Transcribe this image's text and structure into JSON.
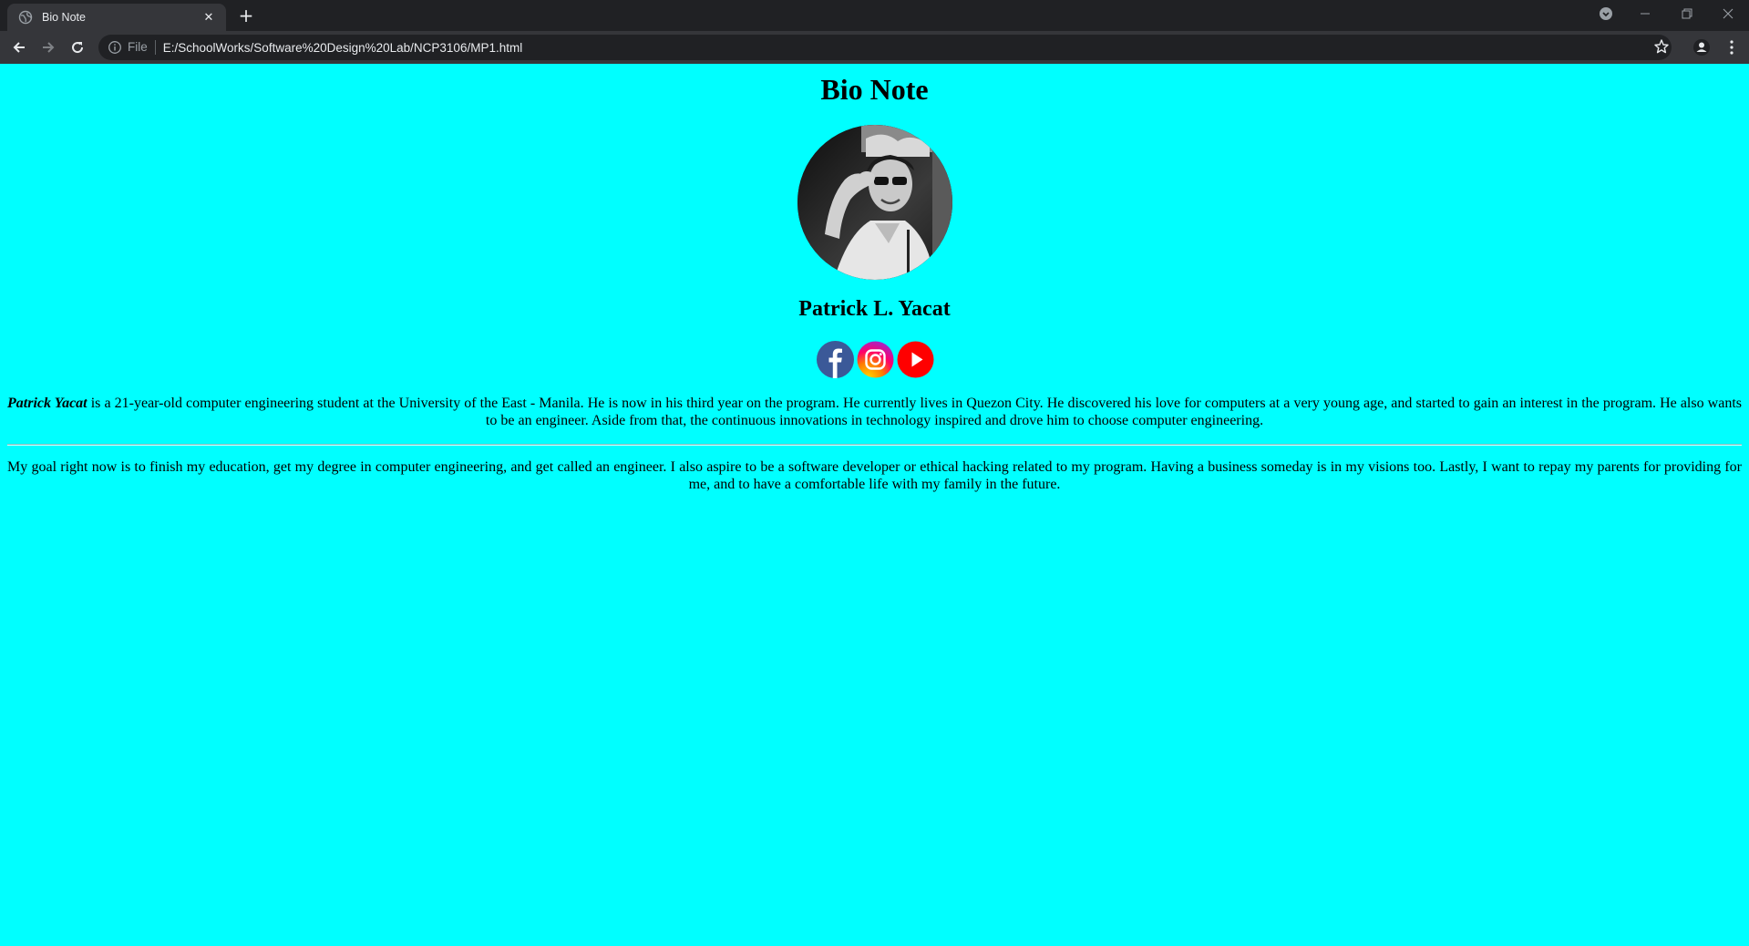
{
  "browser": {
    "tab_title": "Bio Note",
    "tab_close_glyph": "✕",
    "new_tab_glyph": "+",
    "scheme_label": "File",
    "url": "E:/SchoolWorks/Software%20Design%20Lab/NCP3106/MP1.html",
    "icons": [
      "back-arrow-icon",
      "forward-arrow-icon",
      "reload-icon",
      "info-icon",
      "star-icon",
      "profile-icon",
      "menu-icon",
      "minimize-icon",
      "restore-icon",
      "close-window-icon",
      "tab-search-icon"
    ]
  },
  "page": {
    "title": "Bio Note",
    "name": "Patrick L. Yacat",
    "bio_name": "Patrick Yacat",
    "bio_text": " is a 21-year-old computer engineering student at the University of the East - Manila. He is now in his third year on the program. He currently lives in Quezon City. He discovered his love for computers at a very young age, and started to gain an interest in the program. He also wants to be an engineer. Aside from that, the continuous innovations in technology inspired and drove him to choose computer engineering.",
    "goals_text": "My goal right now is to finish my education, get my degree in computer engineering, and get called an engineer. I also aspire to be a software developer or ethical hacking related to my program. Having a business someday is in my visions too. Lastly, I want to repay my parents for providing for me, and to have a comfortable life with my family in the future.",
    "socials": [
      "facebook",
      "instagram",
      "youtube"
    ],
    "colors": {
      "background": "#00ffff",
      "facebook": "#3b5998",
      "youtube": "#ff0000",
      "chrome_dark": "#202124",
      "chrome_tab": "#35363a"
    }
  }
}
